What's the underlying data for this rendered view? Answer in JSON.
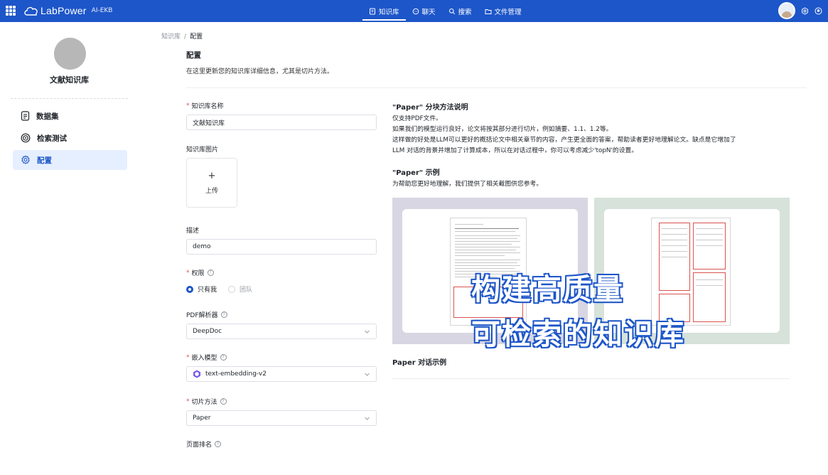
{
  "topbar": {
    "brand": "LabPower",
    "edition": "AI-EKB",
    "nav": [
      {
        "label": "知识库",
        "icon": "book-icon",
        "active": true
      },
      {
        "label": "聊天",
        "icon": "chat-icon",
        "active": false
      },
      {
        "label": "搜索",
        "icon": "search-icon",
        "active": false
      },
      {
        "label": "文件管理",
        "icon": "folder-icon",
        "active": false
      }
    ]
  },
  "sidebar": {
    "kb_name": "文献知识库",
    "items": [
      {
        "label": "数据集",
        "icon": "dataset-icon",
        "active": false
      },
      {
        "label": "检索测试",
        "icon": "retrieval-icon",
        "active": false
      },
      {
        "label": "配置",
        "icon": "gear-icon",
        "active": true
      }
    ]
  },
  "breadcrumb": {
    "root": "知识库",
    "sep": "/",
    "current": "配置"
  },
  "page": {
    "title": "配置",
    "description": "在这里更新您的知识库详细信息，尤其是切片方法。"
  },
  "form": {
    "name_label": "知识库名称",
    "name_value": "文献知识库",
    "image_label": "知识库图片",
    "upload_plus": "+",
    "upload_label": "上传",
    "desc_label": "描述",
    "desc_value": "demo",
    "permission_label": "权限",
    "permission_options": [
      "只有我",
      "团队"
    ],
    "pdf_parser_label": "PDF解析器",
    "pdf_parser_value": "DeepDoc",
    "embedding_label": "嵌入模型",
    "embedding_value": "text-embedding-v2",
    "chunk_label": "切片方法",
    "chunk_value": "Paper",
    "page_rank_label": "页面排名"
  },
  "help_panel": {
    "method_title": "\"Paper\" 分块方法说明",
    "method_lines": [
      "仅支持PDF文件。",
      "如果我们的模型运行良好，论文将按其部分进行切片，例如摘要、1.1、1.2等。",
      "这样做的好处是LLM可以更好的概括论文中相关章节的内容，产生更全面的答案，帮助读者更好地理解论文。缺点是它增加了",
      "LLM 对话的背景并增加了计算成本，所以在对话过程中，你可以考虑减少'topN'的设置。"
    ],
    "example_title": "\"Paper\" 示例",
    "example_desc": "为帮助您更好地理解，我们提供了相关截图供您参考。",
    "overlay_line1": "构建高质量",
    "overlay_line2": "可检索的知识库",
    "dialog_title": "Paper 对话示例"
  }
}
